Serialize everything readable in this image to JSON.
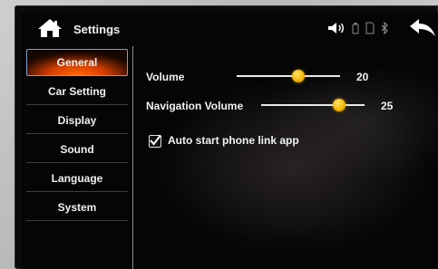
{
  "header": {
    "title": "Settings",
    "home_icon": "home-icon",
    "back_icon": "back-arrow-icon",
    "status_icons": [
      "volume-icon",
      "usb-icon",
      "sd-card-icon",
      "bluetooth-icon"
    ]
  },
  "sidebar": {
    "items": [
      {
        "label": "General",
        "active": true
      },
      {
        "label": "Car Setting",
        "active": false
      },
      {
        "label": "Display",
        "active": false
      },
      {
        "label": "Sound",
        "active": false
      },
      {
        "label": "Language",
        "active": false
      },
      {
        "label": "System",
        "active": false
      }
    ]
  },
  "general": {
    "volume": {
      "label": "Volume",
      "value": "20",
      "level": 0.6
    },
    "nav_volume": {
      "label": "Navigation Volume",
      "value": "25",
      "level": 0.75
    },
    "auto_start": {
      "label": "Auto start phone link app",
      "checked": true
    }
  },
  "colors": {
    "accent": "#ff6a00",
    "knob": "#f2b400",
    "background": "#050506"
  }
}
